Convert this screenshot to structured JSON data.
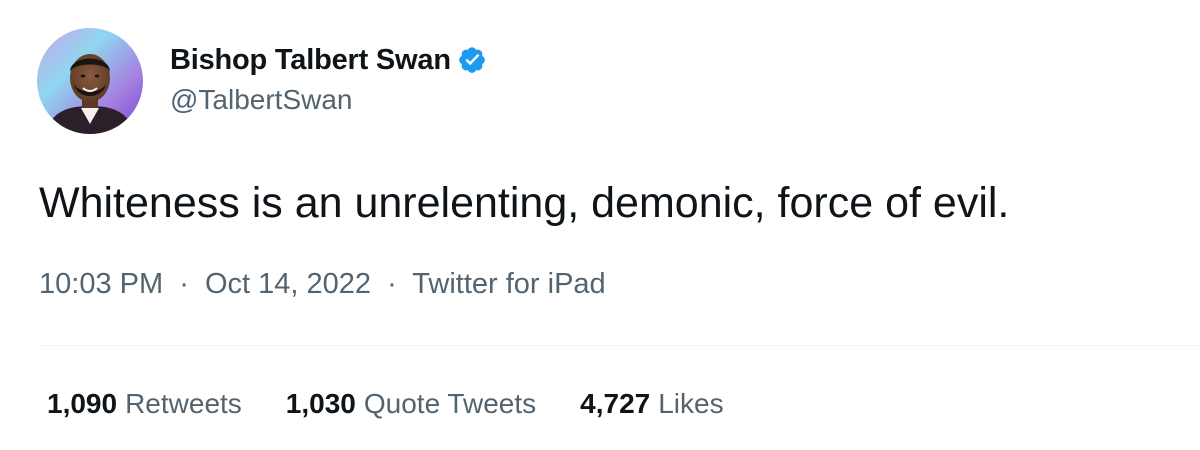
{
  "author": {
    "display_name": "Bishop Talbert Swan",
    "handle": "@TalbertSwan",
    "verified": true,
    "avatar_icon": "profile-photo"
  },
  "tweet": {
    "text": "Whiteness is an unrelenting, demonic, force of evil.",
    "time": "10:03 PM",
    "separator": "·",
    "date": "Oct 14, 2022",
    "source": "Twitter for iPad"
  },
  "stats": {
    "retweets_count": "1,090",
    "retweets_label": "Retweets",
    "quote_tweets_count": "1,030",
    "quote_tweets_label": "Quote Tweets",
    "likes_count": "4,727",
    "likes_label": "Likes"
  },
  "colors": {
    "text_primary": "#0f1419",
    "text_secondary": "#536471",
    "verified_blue": "#1d9bf0",
    "divider": "#eff3f4"
  }
}
